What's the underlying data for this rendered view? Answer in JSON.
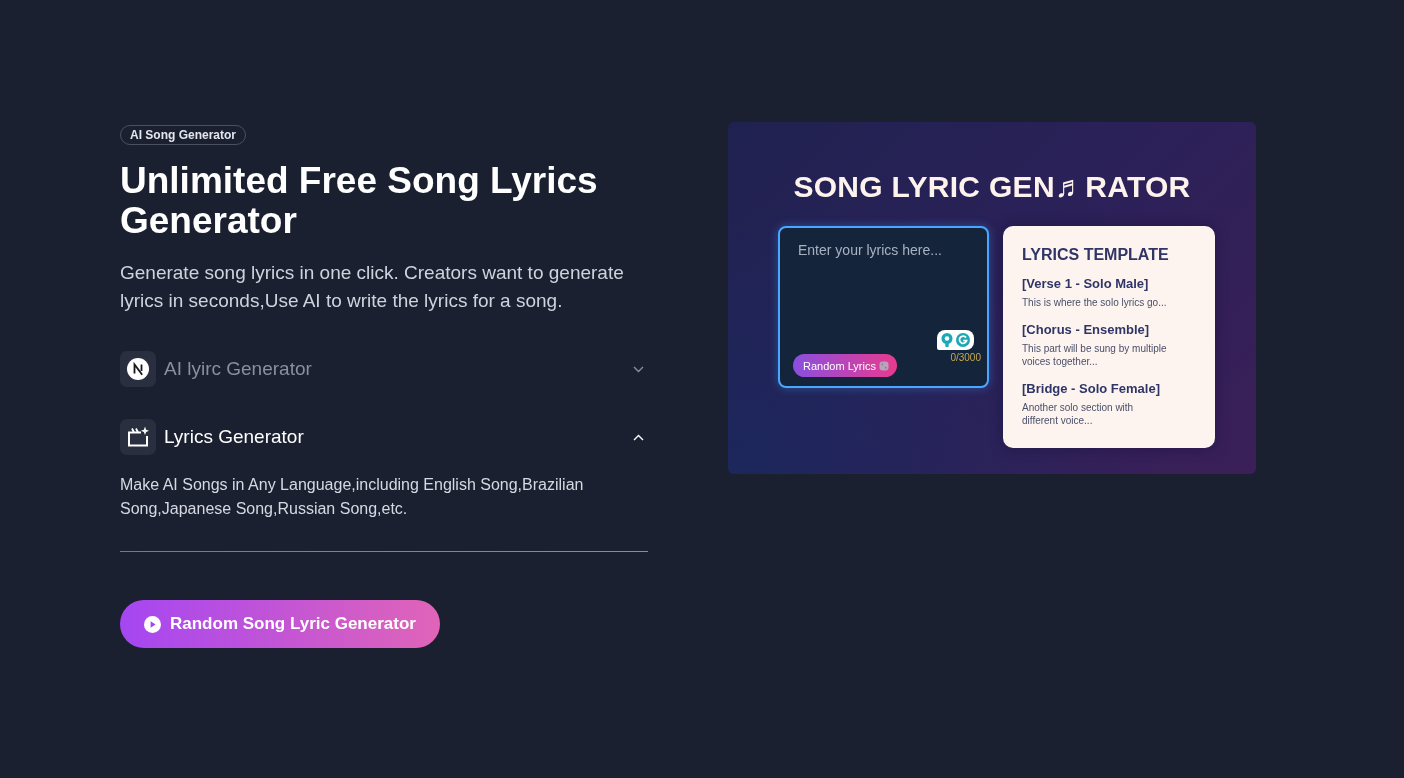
{
  "hero": {
    "badge": "AI Song Generator",
    "title": "Unlimited Free Song Lyrics Generator",
    "description": "Generate song lyrics in one click. Creators want to generate lyrics in seconds,Use AI to write the lyrics for a song."
  },
  "accordion": [
    {
      "label": "AI lyirc Generator",
      "expanded": false
    },
    {
      "label": "Lyrics Generator",
      "expanded": true,
      "body": "Make AI Songs in Any Language,including English Song,Brazilian Song,Japanese Song,Russian Song,etc."
    }
  ],
  "cta_button": {
    "label": "Random Song Lyric Generator"
  },
  "preview": {
    "title": "SONG LYRIC GEN♬RATOR",
    "editor": {
      "placeholder": "Enter your lyrics here...",
      "random_button": "Random Lyrics",
      "counter": "0/3000"
    },
    "template": {
      "title": "LYRICS TEMPLATE",
      "sections": [
        {
          "heading": "[Verse 1 - Solo Male]",
          "text": "This is where the solo lyrics go..."
        },
        {
          "heading": "[Chorus - Ensemble]",
          "text": "This part will be sung by multiple voices together..."
        },
        {
          "heading": "[Bridge - Solo Female]",
          "text": "Another solo section with different voice..."
        }
      ]
    }
  }
}
